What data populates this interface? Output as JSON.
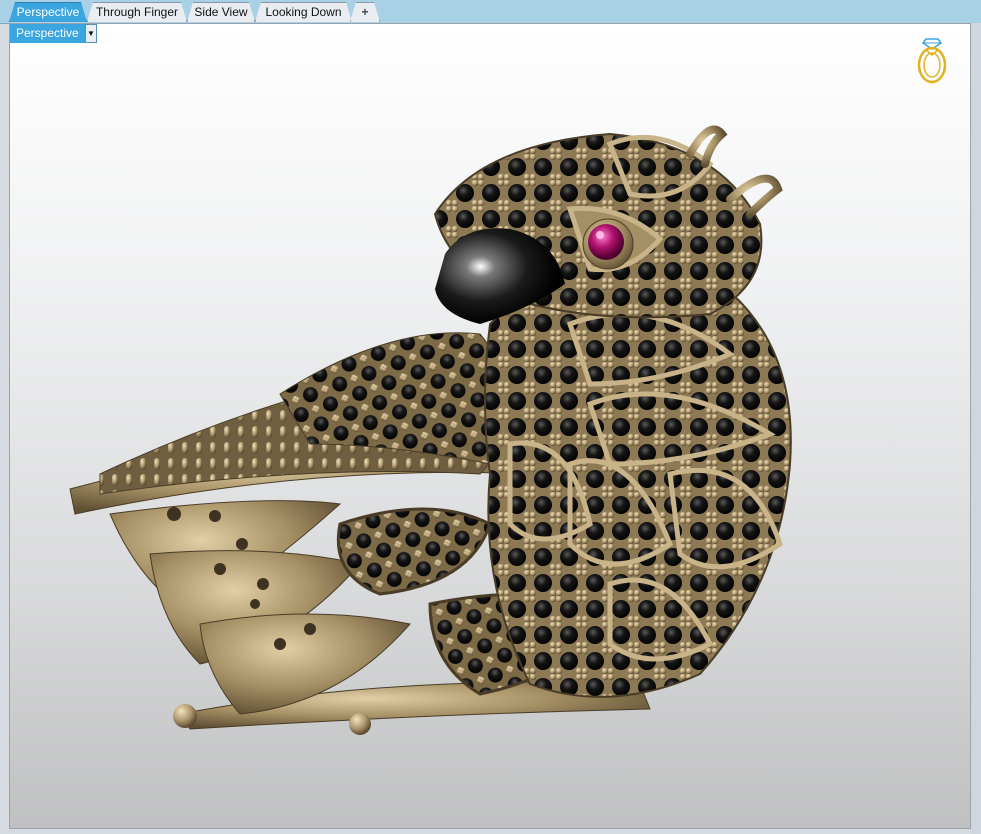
{
  "tabs": [
    {
      "label": "Perspective",
      "active": true
    },
    {
      "label": "Through Finger",
      "active": false
    },
    {
      "label": "Side View",
      "active": false
    },
    {
      "label": "Looking Down",
      "active": false
    }
  ],
  "add_tab_glyph": "+",
  "viewport": {
    "view_label": "Perspective",
    "dropdown_glyph": "▼",
    "corner_icon": "ring-icon",
    "model_icon": "bird-ring-model"
  },
  "colors": {
    "tab_bar": "#a9d1e6",
    "active_tab": "#3aa5de",
    "metal": "#a58f64",
    "stone_black": "#151515",
    "stone_ruby": "#b0126e",
    "ring_icon": "#e2b320"
  }
}
